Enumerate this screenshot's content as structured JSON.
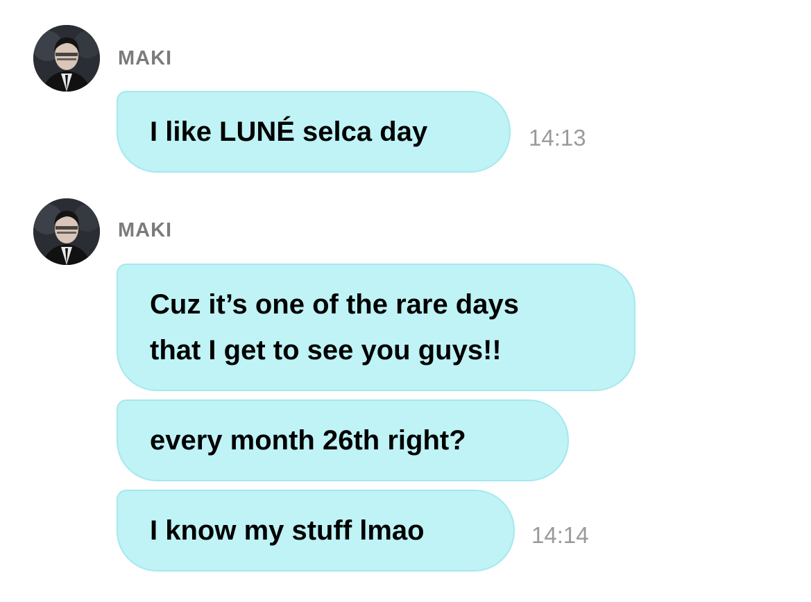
{
  "conversation": {
    "groups": [
      {
        "sender": "MAKI",
        "messages": [
          {
            "text": "I like LUNÉ selca day",
            "time": "14:13"
          }
        ]
      },
      {
        "sender": "MAKI",
        "messages": [
          {
            "text": "Cuz it’s one of the rare days\nthat I get to see you guys!!"
          },
          {
            "text": "every month 26th right?"
          },
          {
            "text": "I know my stuff lmao",
            "time": "14:14"
          }
        ]
      }
    ]
  },
  "colors": {
    "bubble_bg": "#bff3f6",
    "bubble_border": "#a5e8ee",
    "sender_name": "#7b7b7b",
    "timestamp": "#9a9a9a",
    "text": "#000000"
  },
  "icons": [
    "avatar"
  ]
}
